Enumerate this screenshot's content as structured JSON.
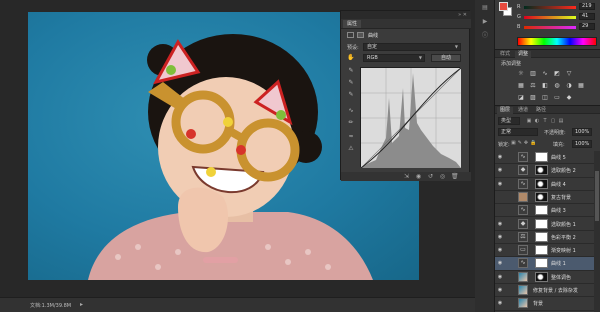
{
  "status": {
    "doc_info": "文档:1.3M/39.8M"
  },
  "curves_panel": {
    "tabs": [
      "属性"
    ],
    "title": "曲线",
    "preset_label": "预设:",
    "preset_value": "自定",
    "channel_value": "RGB",
    "auto_button": "自动"
  },
  "color_panel": {
    "fg_color": "#e84a3e",
    "bg_color": "#ffffff",
    "sliders": [
      {
        "label": "R",
        "value": "219"
      },
      {
        "label": "G",
        "value": "41"
      },
      {
        "label": "B",
        "value": "29"
      }
    ]
  },
  "adjustments_panel": {
    "tabs": [
      "样式",
      "调整"
    ],
    "title": "添加调整"
  },
  "layers_panel": {
    "tabs": [
      "图层",
      "通道",
      "路径"
    ],
    "kind_label": "类型",
    "blend_mode": "正常",
    "opacity_label": "不透明度:",
    "opacity_value": "100%",
    "lock_label": "锁定:",
    "fill_label": "填充:",
    "fill_value": "100%",
    "layers": [
      {
        "name": "曲线 5",
        "type": "curves",
        "mask": "white",
        "visible": true,
        "selected": false
      },
      {
        "name": "选取颜色 2",
        "type": "selective",
        "mask": "dark",
        "visible": true,
        "selected": false
      },
      {
        "name": "曲线 4",
        "type": "curves",
        "mask": "dark",
        "visible": true,
        "selected": false
      },
      {
        "name": "复古背景",
        "type": "fill",
        "mask": "dark",
        "visible": false,
        "selected": false
      },
      {
        "name": "曲线 3",
        "type": "curves",
        "mask": "white",
        "visible": false,
        "selected": false
      },
      {
        "name": "选取颜色 1",
        "type": "selective",
        "mask": "white",
        "visible": true,
        "selected": false
      },
      {
        "name": "色彩平衡 2",
        "type": "balance",
        "mask": "white",
        "visible": true,
        "selected": false
      },
      {
        "name": "渐变映射 1",
        "type": "gradient",
        "mask": "white",
        "visible": true,
        "selected": false
      },
      {
        "name": "曲线 1",
        "type": "curves",
        "mask": "white",
        "visible": true,
        "selected": true
      },
      {
        "name": "整体调色",
        "type": "photo",
        "mask": "dark",
        "visible": true,
        "selected": false
      },
      {
        "name": "修复背景 / 去除杂发",
        "type": "photo",
        "mask": "none",
        "visible": true,
        "selected": false
      },
      {
        "name": "背景",
        "type": "photo",
        "mask": "none",
        "visible": true,
        "selected": false
      }
    ]
  }
}
